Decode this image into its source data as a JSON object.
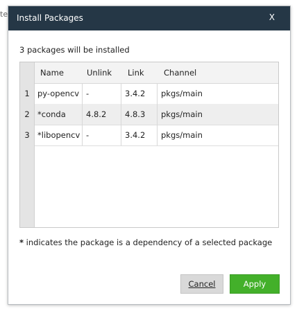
{
  "background": {
    "partial_text": "te"
  },
  "dialog": {
    "title": "Install Packages",
    "close_label": "X",
    "message": "3 packages will be installed",
    "table": {
      "columns": [
        "Name",
        "Unlink",
        "Link",
        "Channel"
      ],
      "rows": [
        {
          "num": "1",
          "name": "py-opencv",
          "unlink": "-",
          "link": "3.4.2",
          "channel": "pkgs/main"
        },
        {
          "num": "2",
          "name": "*conda",
          "unlink": "4.8.2",
          "link": "4.8.3",
          "channel": "pkgs/main"
        },
        {
          "num": "3",
          "name": "*libopencv",
          "unlink": "-",
          "link": "3.4.2",
          "channel": "pkgs/main"
        }
      ]
    },
    "note_star": "*",
    "note_text": " indicates the package is a dependency of a selected package",
    "cancel_label": "Cancel",
    "apply_label": "Apply"
  },
  "colors": {
    "titlebar": "#253746",
    "apply": "#43b02a",
    "cancel": "#d9d9d9"
  }
}
